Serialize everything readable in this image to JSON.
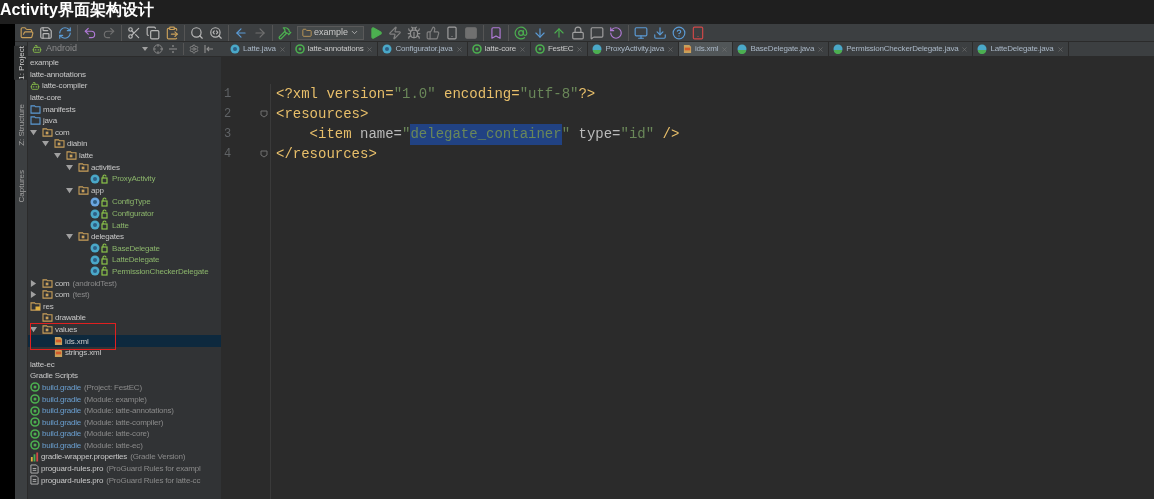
{
  "video_title": "Activity界面架构设计",
  "toolbar": {
    "run_config": "example"
  },
  "side_strip": [
    {
      "label": "1: Project",
      "selected": true
    },
    {
      "label": "Z: Structure",
      "selected": false
    },
    {
      "label": "Captures",
      "selected": false
    }
  ],
  "project_panel": {
    "view": "Android",
    "red_frame": true,
    "tree": [
      {
        "label": "example",
        "kind": "module",
        "selected": false
      },
      {
        "label": "latte-annotations",
        "kind": "module",
        "selected": false
      },
      {
        "label": "latte-compiler",
        "kind": "android_module",
        "selected": false
      },
      {
        "label": "latte-core",
        "kind": "module",
        "selected": false,
        "children": [
          {
            "label": "manifests",
            "kind": "folder",
            "selected": false
          },
          {
            "label": "java",
            "kind": "folder",
            "selected": false,
            "children": [
              {
                "label": "com",
                "kind": "package",
                "expanded": true,
                "selected": false,
                "children": [
                  {
                    "label": "diabin",
                    "kind": "package",
                    "expanded": true,
                    "selected": false,
                    "children": [
                      {
                        "label": "latte",
                        "kind": "package",
                        "expanded": true,
                        "selected": false,
                        "children": [
                          {
                            "label": "activities",
                            "kind": "package",
                            "expanded": true,
                            "selected": false,
                            "children": [
                              {
                                "label": "ProxyActivity",
                                "kind": "class",
                                "selected": false
                              }
                            ]
                          },
                          {
                            "label": "app",
                            "kind": "package",
                            "expanded": true,
                            "selected": false,
                            "children": [
                              {
                                "label": "ConfigType",
                                "kind": "enum",
                                "selected": false
                              },
                              {
                                "label": "Configurator",
                                "kind": "class",
                                "selected": false
                              },
                              {
                                "label": "Latte",
                                "kind": "class",
                                "selected": false
                              }
                            ]
                          },
                          {
                            "label": "delegates",
                            "kind": "package",
                            "expanded": true,
                            "selected": false,
                            "children": [
                              {
                                "label": "BaseDelegate",
                                "kind": "class",
                                "selected": false
                              },
                              {
                                "label": "LatteDelegate",
                                "kind": "class",
                                "selected": false
                              },
                              {
                                "label": "PermissionCheckerDelegate",
                                "kind": "class",
                                "selected": false
                              }
                            ]
                          }
                        ]
                      }
                    ]
                  }
                ]
              },
              {
                "label": "com",
                "note": "(androidTest)",
                "kind": "package",
                "expanded": false,
                "selected": false
              },
              {
                "label": "com",
                "note": "(test)",
                "kind": "package",
                "expanded": false,
                "selected": false
              }
            ]
          },
          {
            "label": "res",
            "kind": "res_folder",
            "selected": false,
            "children": [
              {
                "label": "drawable",
                "kind": "package",
                "selected": false
              },
              {
                "label": "values",
                "kind": "package",
                "expanded": true,
                "selected": false,
                "children": [
                  {
                    "label": "ids.xml",
                    "kind": "xml",
                    "selected": true
                  },
                  {
                    "label": "strings.xml",
                    "kind": "xml",
                    "selected": false
                  }
                ]
              }
            ]
          }
        ]
      },
      {
        "label": "latte-ec",
        "kind": "module",
        "selected": false
      },
      {
        "label": "Gradle Scripts",
        "kind": "module",
        "selected": false,
        "children": [
          {
            "label": "build.gradle",
            "note": "(Project: FestEC)",
            "kind": "gradle",
            "selected": false
          },
          {
            "label": "build.gradle",
            "note": "(Module: example)",
            "kind": "gradle",
            "selected": false
          },
          {
            "label": "build.gradle",
            "note": "(Module: latte-annotations)",
            "kind": "gradle",
            "selected": false
          },
          {
            "label": "build.gradle",
            "note": "(Module: latte-compiler)",
            "kind": "gradle",
            "selected": false
          },
          {
            "label": "build.gradle",
            "note": "(Module: latte-core)",
            "kind": "gradle",
            "selected": false
          },
          {
            "label": "build.gradle",
            "note": "(Module: latte-ec)",
            "kind": "gradle",
            "selected": false
          },
          {
            "label": "gradle-wrapper.properties",
            "note": "(Gradle Version)",
            "kind": "properties",
            "selected": false
          },
          {
            "label": "proguard-rules.pro",
            "note": "(ProGuard Rules for exampl",
            "kind": "text",
            "selected": false
          },
          {
            "label": "proguard-rules.pro",
            "note": "(ProGuard Rules for latte-cc",
            "kind": "text",
            "selected": false
          }
        ]
      }
    ]
  },
  "tabs": [
    {
      "label": "Latte.java",
      "kind": "class",
      "selected": false
    },
    {
      "label": "latte-annotations",
      "kind": "gradle",
      "selected": false
    },
    {
      "label": "Configurator.java",
      "kind": "class",
      "selected": false
    },
    {
      "label": "latte-core",
      "kind": "gradle",
      "selected": false
    },
    {
      "label": "FestEC",
      "kind": "gradle",
      "selected": false
    },
    {
      "label": "ProxyActivity.java",
      "kind": "activity",
      "selected": false
    },
    {
      "label": "ids.xml",
      "kind": "xml",
      "selected": true
    },
    {
      "label": "BaseDelegate.java",
      "kind": "activity",
      "selected": false
    },
    {
      "label": "PermissionCheckerDelegate.java",
      "kind": "activity",
      "selected": false
    },
    {
      "label": "LatteDelegate.java",
      "kind": "activity",
      "selected": false
    }
  ],
  "editor": {
    "lines": [
      {
        "number": "1",
        "fold": false,
        "tokens": [
          {
            "text": "<?xml version=",
            "kind": "tag",
            "selected": false
          },
          {
            "text": "\"1.0\"",
            "kind": "value",
            "selected": false
          },
          {
            "text": " encoding=",
            "kind": "tag",
            "selected": false
          },
          {
            "text": "\"utf-8\"",
            "kind": "value",
            "selected": false
          },
          {
            "text": "?>",
            "kind": "tag",
            "selected": false
          }
        ]
      },
      {
        "number": "2",
        "fold": true,
        "tokens": [
          {
            "text": "<resources>",
            "kind": "tag",
            "selected": false
          }
        ]
      },
      {
        "number": "3",
        "fold": false,
        "tokens": [
          {
            "text": "    <item ",
            "kind": "tag",
            "selected": false
          },
          {
            "text": "name=",
            "kind": "attr",
            "selected": false
          },
          {
            "text": "\"",
            "kind": "value",
            "selected": false
          },
          {
            "text": "delegate_container",
            "kind": "value",
            "selected": true
          },
          {
            "text": "\"",
            "kind": "value",
            "selected": false
          },
          {
            "text": " type=",
            "kind": "attr",
            "selected": false
          },
          {
            "text": "\"id\"",
            "kind": "value",
            "selected": false
          },
          {
            "text": " />",
            "kind": "tag",
            "selected": false
          }
        ]
      },
      {
        "number": "4",
        "fold": true,
        "tokens": [
          {
            "text": "</resources>",
            "kind": "tag",
            "selected": false
          }
        ]
      }
    ]
  }
}
